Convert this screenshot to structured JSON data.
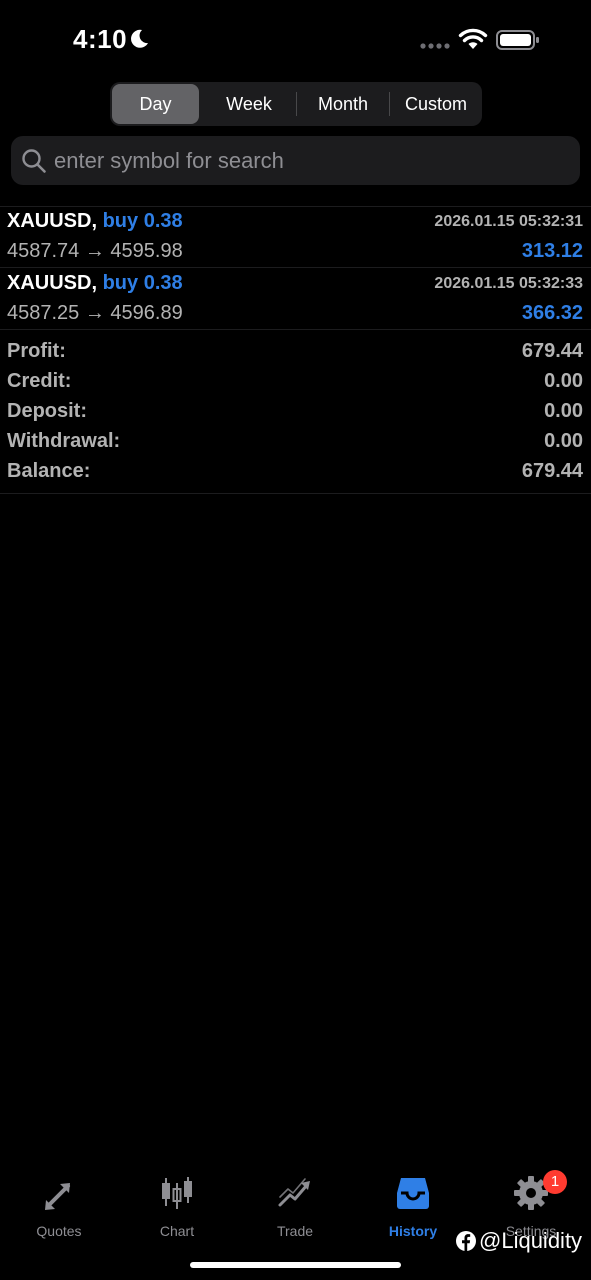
{
  "status_bar": {
    "time": "4:10"
  },
  "period_tabs": [
    {
      "label": "Day",
      "active": true
    },
    {
      "label": "Week",
      "active": false
    },
    {
      "label": "Month",
      "active": false
    },
    {
      "label": "Custom",
      "active": false
    }
  ],
  "search": {
    "placeholder": "enter symbol for search",
    "value": ""
  },
  "trades": [
    {
      "symbol": "XAUUSD,",
      "type_volume": "buy 0.38",
      "time": "2026.01.15 05:32:31",
      "open_price": "4587.74",
      "arrow": "→",
      "close_price": "4595.98",
      "profit": "313.12"
    },
    {
      "symbol": "XAUUSD,",
      "type_volume": "buy 0.38",
      "time": "2026.01.15 05:32:33",
      "open_price": "4587.25",
      "arrow": "→",
      "close_price": "4596.89",
      "profit": "366.32"
    }
  ],
  "summary": [
    {
      "label": "Profit:",
      "value": "679.44"
    },
    {
      "label": "Credit:",
      "value": "0.00"
    },
    {
      "label": "Deposit:",
      "value": "0.00"
    },
    {
      "label": "Withdrawal:",
      "value": "0.00"
    },
    {
      "label": "Balance:",
      "value": "679.44"
    }
  ],
  "tab_bar": [
    {
      "label": "Quotes",
      "icon": "quotes-arrows-icon",
      "active": false
    },
    {
      "label": "Chart",
      "icon": "candlestick-icon",
      "active": false
    },
    {
      "label": "Trade",
      "icon": "trade-trend-icon",
      "active": false
    },
    {
      "label": "History",
      "icon": "inbox-tray-icon",
      "active": true
    },
    {
      "label": "Settings",
      "icon": "gear-icon",
      "active": false,
      "badge": "1"
    }
  ],
  "watermark": {
    "text": "@Liquidity"
  },
  "colors": {
    "background": "#000000",
    "accent_blue": "#2f7fe6",
    "secondary_text": "#b3b3b3",
    "control_bg": "#1c1c1e",
    "segment_active": "#636366",
    "badge_red": "#ff3b30"
  }
}
